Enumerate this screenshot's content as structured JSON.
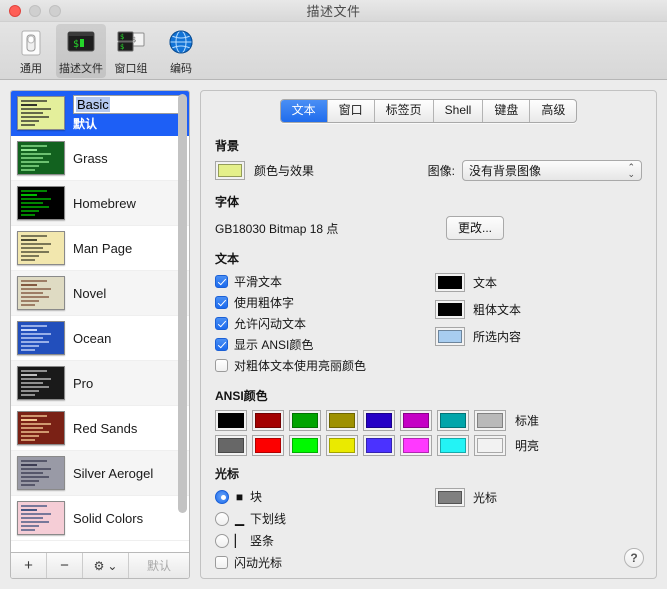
{
  "window": {
    "title": "描述文件",
    "traffic_lights": [
      "close",
      "minimize",
      "zoom"
    ]
  },
  "toolbar": {
    "items": [
      {
        "label": "通用",
        "icon": "general-icon",
        "active": false
      },
      {
        "label": "描述文件",
        "icon": "profiles-terminal-icon",
        "active": true
      },
      {
        "label": "窗口组",
        "icon": "window-groups-icon",
        "active": false
      },
      {
        "label": "编码",
        "icon": "encoding-globe-icon",
        "active": false
      }
    ]
  },
  "profiles": {
    "selected_index": 0,
    "editing_name": "Basic",
    "default_badge": "默认",
    "items": [
      {
        "name": "Basic",
        "bg": "#e4ef9b",
        "fg": "#1f1f1f",
        "selected": true
      },
      {
        "name": "Grass",
        "bg": "#12621f",
        "fg": "#9df29d",
        "selected": false
      },
      {
        "name": "Homebrew",
        "bg": "#000000",
        "fg": "#00d000",
        "selected": false
      },
      {
        "name": "Man Page",
        "bg": "#f2e7ae",
        "fg": "#3a3a28",
        "selected": false
      },
      {
        "name": "Novel",
        "bg": "#dfdbc3",
        "fg": "#7a4b33",
        "selected": false
      },
      {
        "name": "Ocean",
        "bg": "#224fbc",
        "fg": "#d8e4ff",
        "selected": false
      },
      {
        "name": "Pro",
        "bg": "#1a1a1a",
        "fg": "#d0d0d0",
        "selected": false
      },
      {
        "name": "Red Sands",
        "bg": "#7a2115",
        "fg": "#ffd9a0",
        "selected": false
      },
      {
        "name": "Silver Aerogel",
        "bg": "#999aa6",
        "fg": "#33334a",
        "selected": false
      },
      {
        "name": "Solid Colors",
        "bg": "#f5cdd6",
        "fg": "#334a7a",
        "selected": false
      }
    ],
    "footer": {
      "add": "+",
      "remove": "−",
      "gear": "⚙",
      "gear_chevron": "⌄",
      "default_button": "默认"
    }
  },
  "tabs": [
    {
      "label": "文本",
      "active": true
    },
    {
      "label": "窗口",
      "active": false
    },
    {
      "label": "标签页",
      "active": false
    },
    {
      "label": "Shell",
      "active": false
    },
    {
      "label": "键盘",
      "active": false
    },
    {
      "label": "高级",
      "active": false
    }
  ],
  "text_tab": {
    "background": {
      "title": "背景",
      "color_label": "颜色与效果",
      "color_value": "#e4f08a",
      "image_label": "图像:",
      "image_value": "没有背景图像"
    },
    "font": {
      "title": "字体",
      "value": "GB18030 Bitmap 18 点",
      "change_button": "更改..."
    },
    "text": {
      "title": "文本",
      "checkboxes": [
        {
          "label": "平滑文本",
          "checked": true
        },
        {
          "label": "使用粗体字",
          "checked": true
        },
        {
          "label": "允许闪动文本",
          "checked": true
        },
        {
          "label": "显示 ANSI颜色",
          "checked": true
        },
        {
          "label": "对粗体文本使用亮丽颜色",
          "checked": false
        }
      ],
      "swatches": [
        {
          "label": "文本",
          "color": "#000000"
        },
        {
          "label": "粗体文本",
          "color": "#000000"
        },
        {
          "label": "所选内容",
          "color": "#a8cdf0"
        }
      ]
    },
    "ansi": {
      "title": "ANSI颜色",
      "rows": [
        {
          "label": "标准",
          "colors": [
            "#000000",
            "#a30000",
            "#00a400",
            "#9e9100",
            "#2500c6",
            "#c500c5",
            "#00a5aa",
            "#b9b9b9"
          ]
        },
        {
          "label": "明亮",
          "colors": [
            "#676767",
            "#fc0000",
            "#00f900",
            "#eaea00",
            "#4b32ff",
            "#ff39ff",
            "#23f3f5",
            "#f2f2f2"
          ]
        }
      ]
    },
    "cursor": {
      "title": "光标",
      "options": [
        {
          "label": "块",
          "glyph": "■",
          "selected": true
        },
        {
          "label": "下划线",
          "glyph": "▁",
          "selected": false
        },
        {
          "label": "竖条",
          "glyph": "▏",
          "selected": false
        }
      ],
      "blink": {
        "label": "闪动光标",
        "checked": false
      },
      "swatch": {
        "label": "光标",
        "color": "#808080"
      }
    },
    "help_button": "?"
  }
}
